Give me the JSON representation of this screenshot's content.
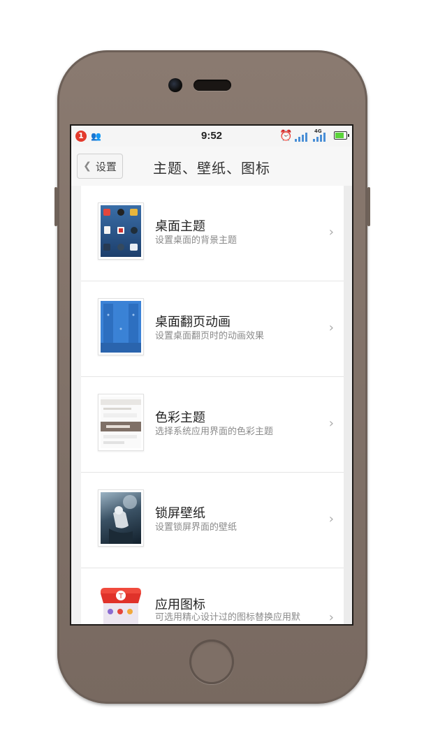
{
  "status_bar": {
    "notification_count": "1",
    "time": "9:52",
    "network_label": "4G"
  },
  "nav": {
    "back_label": "设置",
    "title": "主题、壁纸、图标"
  },
  "items": [
    {
      "title": "桌面主题",
      "subtitle": "设置桌面的背景主题",
      "icon": "desktop-theme-icon"
    },
    {
      "title": "桌面翻页动画",
      "subtitle": "设置桌面翻页时的动画效果",
      "icon": "page-animation-icon"
    },
    {
      "title": "色彩主题",
      "subtitle": "选择系统应用界面的色彩主题",
      "icon": "color-theme-icon"
    },
    {
      "title": "锁屏壁纸",
      "subtitle": "设置锁屏界面的壁纸",
      "icon": "lockscreen-wallpaper-icon"
    },
    {
      "title": "应用图标",
      "subtitle": "可选用精心设计过的图标替换应用默认图标",
      "icon": "app-icon-set-icon"
    }
  ],
  "colors": {
    "phone_body": "#7f7067",
    "accent_blue": "#3b7fd0",
    "alert_red": "#e33a2c"
  }
}
